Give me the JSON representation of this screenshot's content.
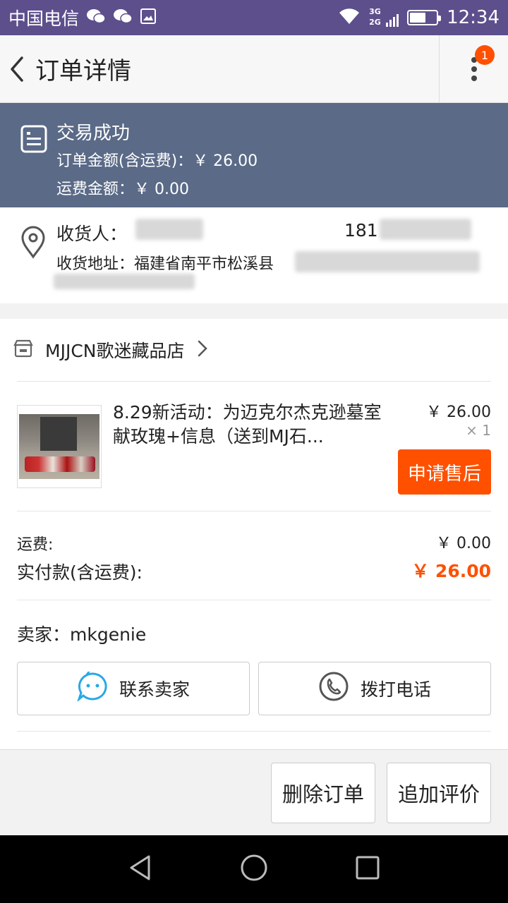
{
  "status_bar": {
    "carrier": "中国电信",
    "network_top": "3G",
    "network_bottom": "2G",
    "time": "12:34"
  },
  "app_bar": {
    "title": "订单详情",
    "badge": "1"
  },
  "order_status": {
    "status": "交易成功",
    "total_line": "订单金额(含运费)：￥ 26.00",
    "shipping_line": "运费金额：￥ 0.00"
  },
  "address": {
    "receiver_label": "收货人：",
    "phone_prefix": "181",
    "address_line": "收货地址：福建省南平市松溪县"
  },
  "store": {
    "name": "MJJCN歌迷藏品店"
  },
  "item": {
    "title": "8.29新活动：为迈克尔杰克逊墓室献玫瑰+信息（送到MJ石...",
    "price": "￥ 26.00",
    "quantity": "× 1",
    "after_sale_label": "申请售后"
  },
  "summary": {
    "shipping_label": "运费:",
    "shipping_value": "￥ 0.00",
    "paid_label": "实付款(含运费):",
    "paid_value": "￥ 26.00"
  },
  "seller": {
    "label": "卖家：mkgenie",
    "contact_label": "联系卖家",
    "call_label": "拨打电话"
  },
  "actions": {
    "delete_label": "删除订单",
    "review_label": "追加评价"
  },
  "colors": {
    "status_bar": "#5d4f8c",
    "banner": "#5a6a87",
    "accent": "#ff5000",
    "contact_icon": "#2aa8e6"
  }
}
